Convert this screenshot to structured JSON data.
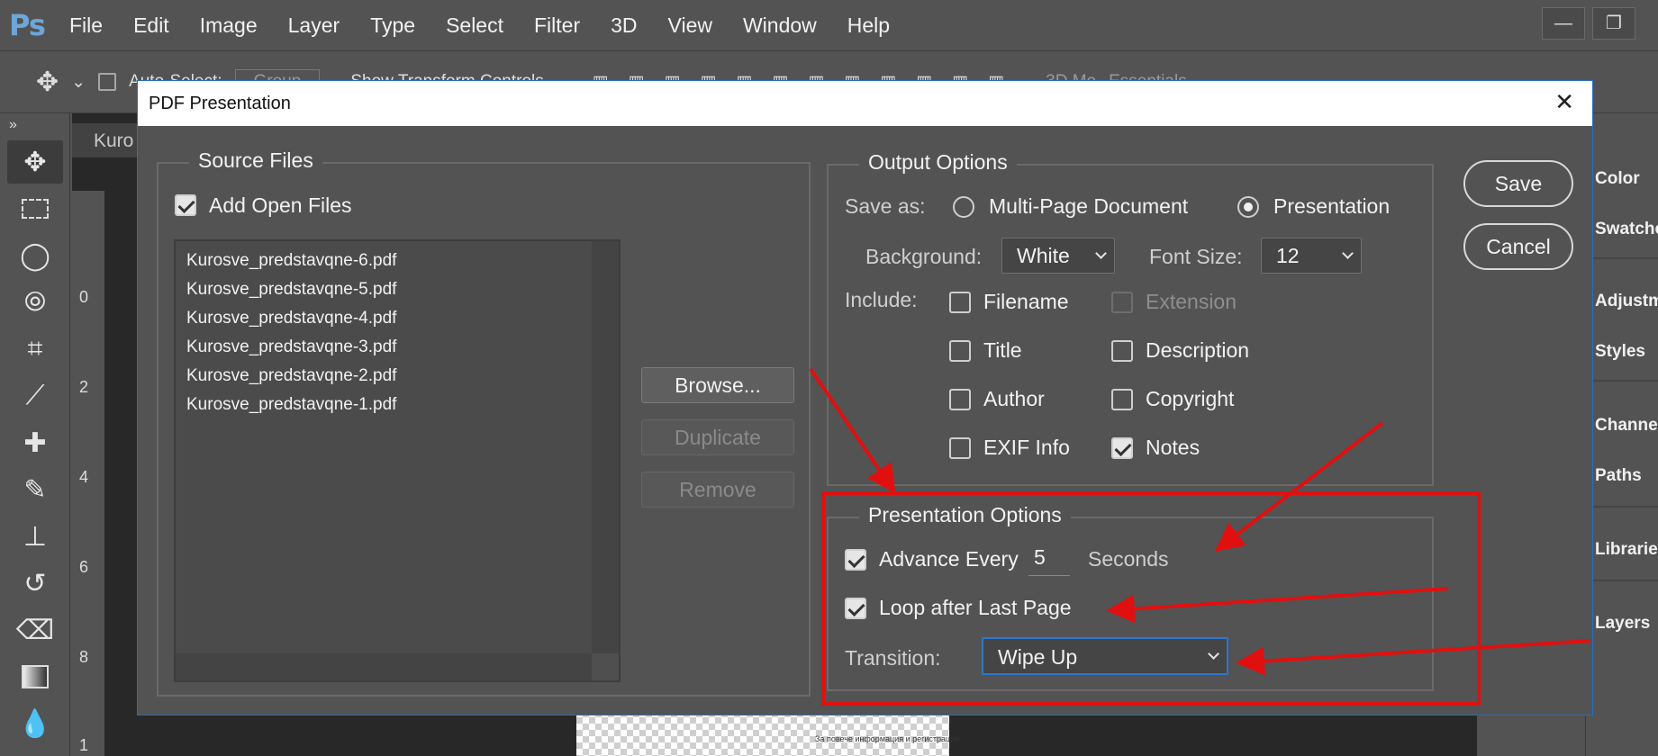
{
  "app": {
    "logo": "Ps",
    "menu": [
      "File",
      "Edit",
      "Image",
      "Layer",
      "Type",
      "Select",
      "Filter",
      "3D",
      "View",
      "Window",
      "Help"
    ],
    "window_buttons": [
      "minimize-icon",
      "restore-icon"
    ]
  },
  "options_bar": {
    "auto_select": "Auto-Select:",
    "group": "Group",
    "show_transform": "Show Transform Controls",
    "mode_3d": "3D Mo",
    "workspace": "Essentials"
  },
  "toolbar": {
    "tools": [
      "move-tool-icon",
      "marquee-tool-icon",
      "lasso-tool-icon",
      "quick-select-tool-icon",
      "crop-tool-icon",
      "eyedropper-tool-icon",
      "healing-brush-tool-icon",
      "brush-tool-icon",
      "stamp-tool-icon",
      "history-brush-tool-icon",
      "eraser-tool-icon",
      "gradient-tool-icon",
      "blur-tool-icon"
    ],
    "expand": "»"
  },
  "document": {
    "tab_label": "Kuro",
    "ruler_marks": [
      "0",
      "2",
      "4",
      "6",
      "8",
      "1"
    ],
    "canvas_text": "За повече информация и регистрация"
  },
  "panels": [
    "Color",
    "Swatche",
    "Adjustm",
    "Styles",
    "Channe",
    "Paths",
    "Librarie",
    "Layers"
  ],
  "dialog": {
    "title": "PDF Presentation",
    "close": "✕",
    "source": {
      "legend": "Source Files",
      "add_open_files": "Add Open Files",
      "add_open_files_checked": true,
      "files": [
        "Kurosve_predstavqne-6.pdf",
        "Kurosve_predstavqne-5.pdf",
        "Kurosve_predstavqne-4.pdf",
        "Kurosve_predstavqne-3.pdf",
        "Kurosve_predstavqne-2.pdf",
        "Kurosve_predstavqne-1.pdf"
      ],
      "browse": "Browse...",
      "duplicate": "Duplicate",
      "remove": "Remove"
    },
    "output": {
      "legend": "Output Options",
      "save_as_label": "Save as:",
      "multi_page": "Multi-Page Document",
      "presentation": "Presentation",
      "selected": "Presentation",
      "background_label": "Background:",
      "background_value": "White",
      "font_size_label": "Font Size:",
      "font_size_value": "12",
      "include_label": "Include:",
      "include": {
        "filename": {
          "label": "Filename",
          "checked": false
        },
        "extension": {
          "label": "Extension",
          "checked": false,
          "disabled": true
        },
        "title": {
          "label": "Title",
          "checked": false
        },
        "description": {
          "label": "Description",
          "checked": false
        },
        "author": {
          "label": "Author",
          "checked": false
        },
        "copyright": {
          "label": "Copyright",
          "checked": false
        },
        "exif": {
          "label": "EXIF Info",
          "checked": false
        },
        "notes": {
          "label": "Notes",
          "checked": true
        }
      }
    },
    "presentation": {
      "legend": "Presentation Options",
      "advance_label": "Advance Every",
      "advance_checked": true,
      "advance_value": "5",
      "seconds": "Seconds",
      "loop_label": "Loop after Last Page",
      "loop_checked": true,
      "transition_label": "Transition:",
      "transition_value": "Wipe Up"
    },
    "save": "Save",
    "cancel": "Cancel"
  },
  "annotation_color": "#e01010"
}
